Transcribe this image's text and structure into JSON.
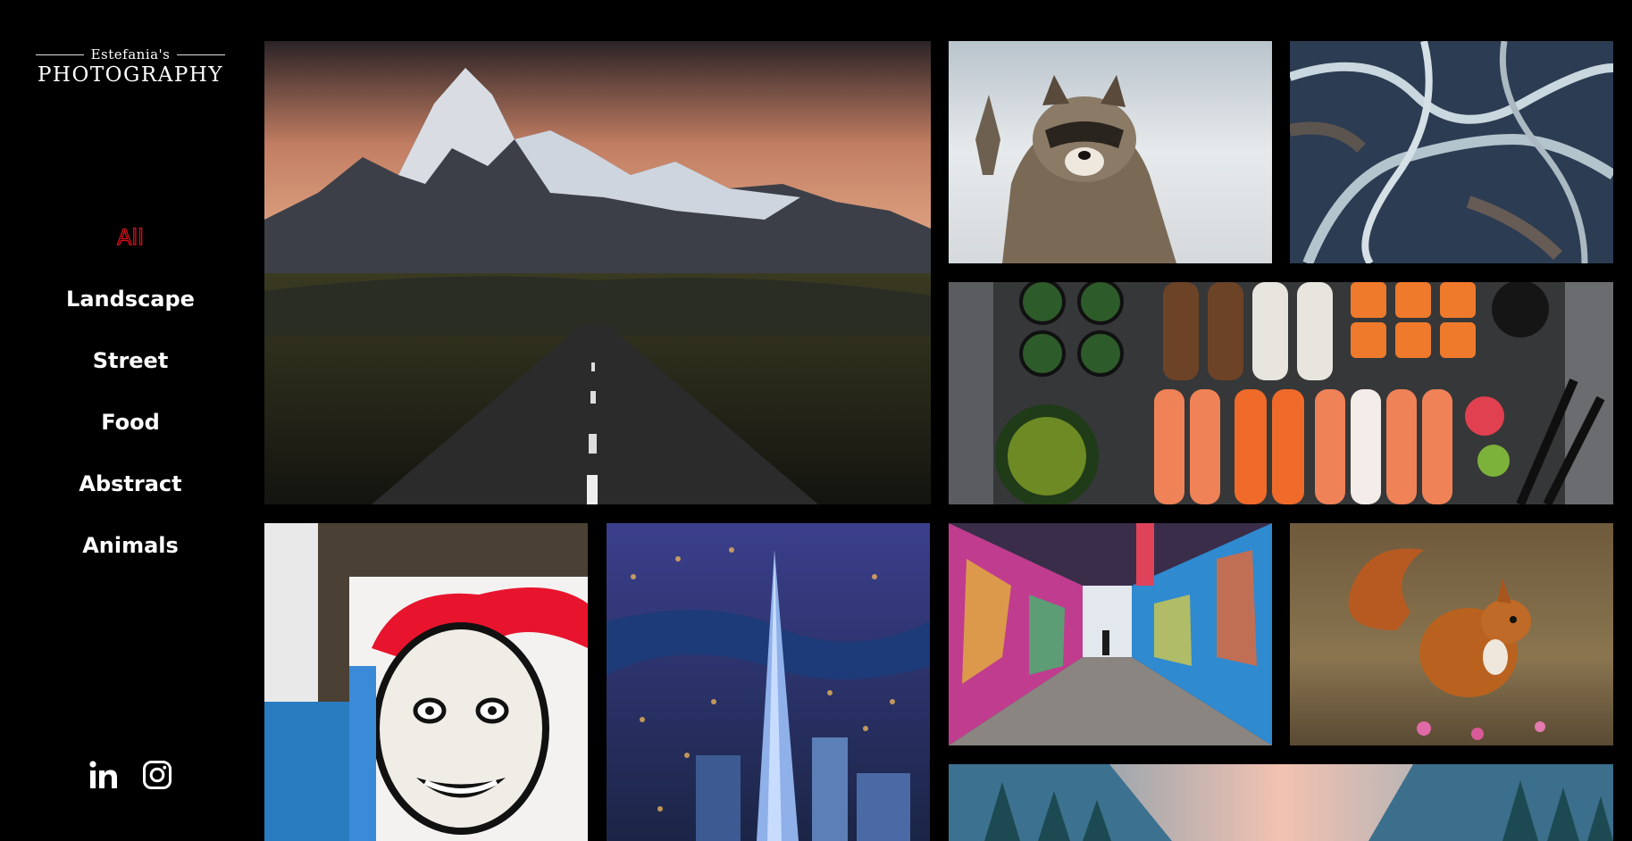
{
  "brand": {
    "top": "Estefania's",
    "main": "PHOTOGRAPHY"
  },
  "nav": [
    {
      "label": "All",
      "active": true
    },
    {
      "label": "Landscape"
    },
    {
      "label": "Street"
    },
    {
      "label": "Food"
    },
    {
      "label": "Abstract"
    },
    {
      "label": "Animals"
    }
  ],
  "social": [
    "linkedin-icon",
    "instagram-icon"
  ],
  "colors": {
    "background": "#000000",
    "active_nav": "#e0101e",
    "text": "#ffffff"
  },
  "gallery": [
    {
      "id": "mountain-road"
    },
    {
      "id": "raccoon"
    },
    {
      "id": "aerial-rivers"
    },
    {
      "id": "sushi"
    },
    {
      "id": "street-art-face"
    },
    {
      "id": "city-night"
    },
    {
      "id": "graffiti-alley"
    },
    {
      "id": "red-squirrel"
    },
    {
      "id": "forest-valley"
    }
  ]
}
